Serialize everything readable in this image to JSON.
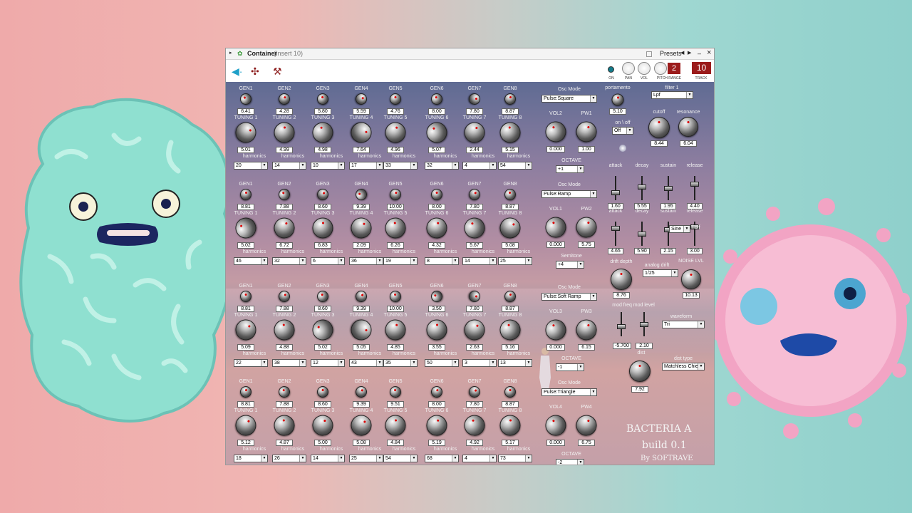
{
  "window": {
    "title": "Container",
    "insert": "(Insert 10)",
    "presets_label": "Presets",
    "minimize_icon": "–",
    "close_icon": "×"
  },
  "header": {
    "on_label": "ON",
    "pan_label": "PAN",
    "vol_label": "VOL",
    "pitch_range_label": "PITCH RANGE",
    "pitch_range_value": "2",
    "track_label": "TRACK",
    "track_value": "10"
  },
  "oscillators": [
    {
      "gen": [
        "GEN1",
        "GEN2",
        "GEN3",
        "GEN4",
        "GEN5",
        "GEN6",
        "GEN7",
        "GEN8"
      ],
      "gen_values": [
        "6.41",
        "4.28",
        "5.80",
        "5.59",
        "4.76",
        "8.00",
        "7.80",
        "8.87"
      ],
      "tuning": [
        "TUNING 1",
        "TUNING 2",
        "TUNING 3",
        "TUNING 4",
        "TUNING 5",
        "TUNING 6",
        "TUNING 7",
        "TUNING 8"
      ],
      "tuning_values": [
        "5.01",
        "4.99",
        "4.98",
        "7.64",
        "4.96",
        "5.07",
        "2.44",
        "5.15"
      ],
      "harmonics_label": "harmonics",
      "harmonics": [
        "20",
        "14",
        "10",
        "17",
        "33",
        "32",
        "4",
        "54"
      ]
    },
    {
      "gen": [
        "GEN1",
        "GEN2",
        "GEN3",
        "GEN4",
        "GEN5",
        "GEN6",
        "GEN7",
        "GEN8"
      ],
      "gen_values": [
        "8.81",
        "7.88",
        "8.60",
        "9.39",
        "10.00",
        "8.00",
        "7.80",
        "8.87"
      ],
      "tuning": [
        "TUNING 1",
        "TUNING 2",
        "TUNING 3",
        "TUNING 4",
        "TUNING 5",
        "TUNING 6",
        "TUNING 7",
        "TUNING 8"
      ],
      "tuning_values": [
        "5.02",
        "6.72",
        "6.83",
        "2.09",
        "6.26",
        "4.32",
        "5.67",
        "5.08"
      ],
      "harmonics_label": "harmonics",
      "harmonics": [
        "46",
        "32",
        "6",
        "36",
        "19",
        "8",
        "14",
        "25"
      ]
    },
    {
      "gen": [
        "GEN1",
        "GEN2",
        "GEN3",
        "GEN4",
        "GEN5",
        "GEN6",
        "GEN7",
        "GEN8"
      ],
      "gen_values": [
        "8.81",
        "7.88",
        "8.60",
        "9.39",
        "10.00",
        "3.50",
        "7.80",
        "8.87"
      ],
      "tuning": [
        "TUNING 1",
        "TUNING 2",
        "TUNING 3",
        "TUNING 4",
        "TUNING 5",
        "TUNING 6",
        "TUNING 7",
        "TUNING 8"
      ],
      "tuning_values": [
        "5.09",
        "4.88",
        "5.02",
        "5.05",
        "4.85",
        "3.55",
        "2.63",
        "5.16"
      ],
      "harmonics_label": "harmonics",
      "harmonics": [
        "22",
        "38",
        "12",
        "43",
        "35",
        "50",
        "3",
        "13"
      ]
    },
    {
      "gen": [
        "GEN1",
        "GEN2",
        "GEN3",
        "GEN4",
        "GEN5",
        "GEN6",
        "GEN7",
        "GEN8"
      ],
      "gen_values": [
        "8.81",
        "7.88",
        "8.60",
        "9.39",
        "9.51",
        "8.00",
        "7.80",
        "8.87"
      ],
      "tuning": [
        "TUNING 1",
        "TUNING 2",
        "TUNING 3",
        "TUNING 4",
        "TUNING 5",
        "TUNING 6",
        "TUNING 7",
        "TUNING 8"
      ],
      "tuning_values": [
        "5.12",
        "4.87",
        "5.00",
        "5.08",
        "4.84",
        "5.19",
        "4.92",
        "5.17"
      ],
      "harmonics_label": "harmonics",
      "harmonics": [
        "18",
        "26",
        "14",
        "25",
        "54",
        "68",
        "4",
        "73"
      ]
    }
  ],
  "osc_sections": [
    {
      "mode_label": "Osc Mode",
      "mode": "Pulse:Square",
      "vol_label": "VOL2",
      "vol": "0.000",
      "pw_label": "PW1",
      "pw": "1.00",
      "pitch_label": "OCTAVE",
      "pitch": "+1"
    },
    {
      "mode_label": "Osc Mode",
      "mode": "Pulse:Ramp",
      "vol_label": "VOL1",
      "vol": "0.000",
      "pw_label": "PW2",
      "pw": "5.75",
      "pitch_label": "Semitone",
      "pitch": "+4"
    },
    {
      "mode_label": "Osc Mode",
      "mode": "Pulse:Soft Ramp",
      "vol_label": "VOL3",
      "vol": "0.000",
      "pw_label": "PW3",
      "pw": "6.15",
      "pitch_label": "OCTAVE",
      "pitch": "-1"
    },
    {
      "mode_label": "Osc Mode",
      "mode": "Pulse:Triangle",
      "vol_label": "VOL4",
      "vol": "0.000",
      "pw_label": "PW4",
      "pw": "6.75",
      "pitch_label": "OCTAVE",
      "pitch": "-2"
    }
  ],
  "right": {
    "portamento_label": "portamento",
    "portamento": "5.10",
    "onoff1_label": "on \\ off",
    "onoff1": "Off",
    "filter_label": "filter 1",
    "filter": "Lpf",
    "cutoff_label": "cutoff",
    "cutoff": "8.44",
    "resonance_label": "resonance",
    "resonance": "6.04",
    "env1_labels": [
      "attack",
      "decay",
      "sustain",
      "release"
    ],
    "env1_values": [
      "1.60",
      "5.55",
      "1.95",
      "4.40"
    ],
    "env2_labels": [
      "attack",
      "decay",
      "sustain",
      "release"
    ],
    "env2_values": [
      "4.65",
      "5.90",
      "2.15",
      "3.00"
    ],
    "onoff2_label": "on \\ off",
    "onoff2": "Sine",
    "drift_depth_label": "drift depth",
    "drift_depth": "8.76",
    "analog_drift_label": "analog drift",
    "analog_drift": "1/25",
    "noise_label": "NOISE LVL",
    "noise": "10.13",
    "mod_label": "mod freq mod level",
    "mod_freq": "-5.700",
    "mod_level": "2.10",
    "waveform_label": "waveform",
    "waveform": "Tri",
    "dist_label": "dist",
    "dist": "7.92",
    "dist_type_label": "dist type",
    "dist_type": "Matchless Chie"
  },
  "brand": {
    "line1": "BACTERIA A",
    "line2": "build 0.1",
    "line3": "By SOFTRAVE"
  },
  "colors": {
    "track_badge": "#9b1b1b",
    "accent": "#1ea0c8",
    "knob_indicator": "#dd0000"
  },
  "icons": [
    "tool-arrow-icon",
    "plugin-settings-icon",
    "wrench-icon",
    "plugin-leaf-icon"
  ]
}
